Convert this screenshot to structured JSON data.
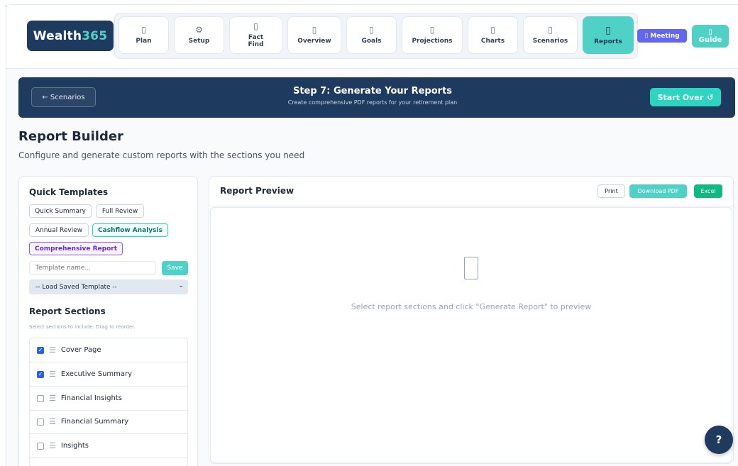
{
  "brand": {
    "name": "Wealth",
    "suffix": "365"
  },
  "nav": {
    "tabs": [
      {
        "label": "Plan",
        "icon": "document-icon",
        "glyph": "▯"
      },
      {
        "label": "Setup",
        "icon": "gear-icon",
        "glyph": "⚙"
      },
      {
        "label": "Fact Find",
        "icon": "clipboard-icon",
        "glyph": "▯"
      },
      {
        "label": "Overview",
        "icon": "overview-icon",
        "glyph": "▯"
      },
      {
        "label": "Goals",
        "icon": "target-icon",
        "glyph": "▯"
      },
      {
        "label": "Projections",
        "icon": "trend-icon",
        "glyph": "▯"
      },
      {
        "label": "Charts",
        "icon": "chart-icon",
        "glyph": "▯"
      },
      {
        "label": "Scenarios",
        "icon": "scenarios-icon",
        "glyph": "▯"
      },
      {
        "label": "Reports",
        "icon": "report-icon",
        "glyph": "▯",
        "active": true
      }
    ],
    "meeting_label": "Meeting",
    "meeting_glyph": "▯",
    "guide_label": "Guide",
    "guide_glyph": "▯"
  },
  "banner": {
    "back_label": "← Scenarios",
    "title": "Step 7: Generate Your Reports",
    "subtitle": "Create comprehensive PDF reports for your retirement plan",
    "start_over_label": "Start Over",
    "start_over_glyph": "↺"
  },
  "page": {
    "title": "Report Builder",
    "subtitle": "Configure and generate custom reports with the sections you need"
  },
  "templates": {
    "heading": "Quick Templates",
    "items": [
      "Quick Summary",
      "Full Review",
      "Annual Review",
      "Cashflow Analysis",
      "Comprehensive Report"
    ],
    "name_placeholder": "Template name...",
    "save_label": "Save",
    "load_selected": "-- Load Saved Template --"
  },
  "sections": {
    "heading": "Report Sections",
    "hint": "Select sections to include. Drag to reorder.",
    "items": [
      {
        "label": "Cover Page",
        "checked": true
      },
      {
        "label": "Executive Summary",
        "checked": true
      },
      {
        "label": "Financial Insights",
        "checked": false
      },
      {
        "label": "Financial Summary",
        "checked": false
      },
      {
        "label": "Insights",
        "checked": false
      }
    ]
  },
  "preview": {
    "title": "Report Preview",
    "print_label": "Print",
    "pdf_label": "Download PDF",
    "excel_label": "Excel",
    "empty_message": "Select report sections and click \"Generate Report\" to preview"
  },
  "help_label": "?",
  "colors": {
    "navy": "#1e3a5f",
    "teal": "#4fd1c5",
    "purple": "#6366f1",
    "green": "#10b981"
  }
}
